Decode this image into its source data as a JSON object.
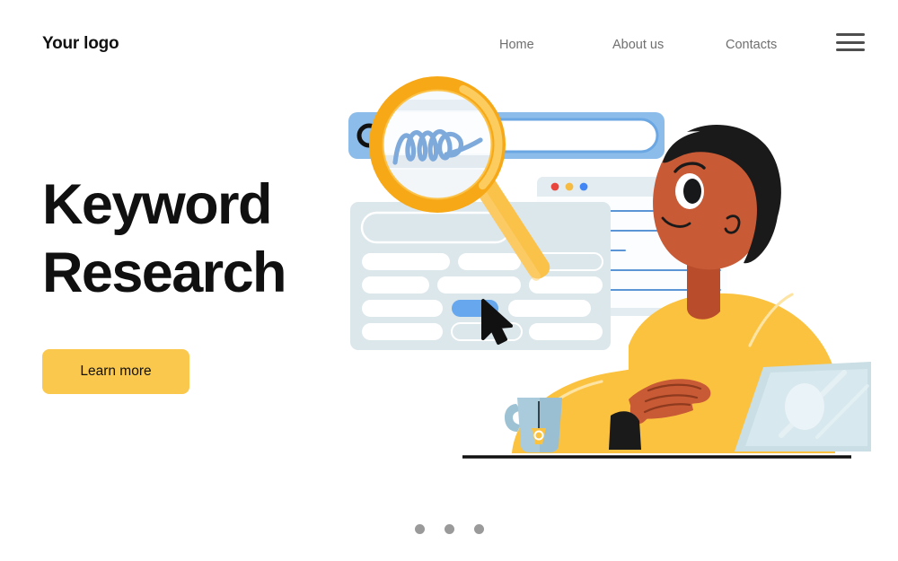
{
  "header": {
    "logo": "Your logo",
    "nav_items": [
      {
        "label": "Home"
      },
      {
        "label": "About us"
      },
      {
        "label": "Contacts"
      }
    ],
    "menu_icon": "hamburger-menu-icon"
  },
  "hero": {
    "title_line1": "Keyword",
    "title_line2": "Research",
    "cta_label": "Learn more",
    "cta_color": "#FBC84E",
    "title_color": "#101010"
  },
  "carousel": {
    "dots": [
      {
        "active": false
      },
      {
        "active": false
      },
      {
        "active": false
      }
    ],
    "dot_color": "#9a9a9a"
  },
  "illustration": {
    "name": "keyword-research-illustration",
    "search_bar": {
      "name": "search-bar",
      "bar_color": "#8CBCEA",
      "field_color": "#ffffff",
      "icon": "search-magnifier-icon",
      "handwriting": "blue-cursive-scribble",
      "handwriting_color": "#7EA9DB"
    },
    "magnifier": {
      "name": "magnifying-glass",
      "ring_color": "#FBB021",
      "ring_highlight": "#FDCC5E",
      "handle_color": "#FBC24A",
      "lens_color": "#F6F9FC"
    },
    "results_panel": {
      "name": "keyword-results-panel",
      "panel_color": "#DCE7EC",
      "pill_color": "#ffffff",
      "selected_pill_color": "#67A7EE",
      "rows": 4,
      "columns": 3
    },
    "browser_window": {
      "name": "browser-window",
      "frame_color": "#E3EDF1",
      "traffic_lights": [
        "#E8453C",
        "#F6BB42",
        "#4285F4"
      ],
      "line_color": "#5B95D6"
    },
    "person": {
      "name": "person-at-laptop",
      "skin_color": "#C85A35",
      "hair_color": "#1A1A1A",
      "shirt_color": "#FBC240"
    },
    "laptop": {
      "name": "laptop",
      "screen_color": "#C9DEE5"
    },
    "mug": {
      "name": "coffee-mug",
      "body_color": "#9CC2D4",
      "tag_color": "#FBC240"
    },
    "desk": {
      "name": "desk-line",
      "color": "#111111"
    }
  }
}
